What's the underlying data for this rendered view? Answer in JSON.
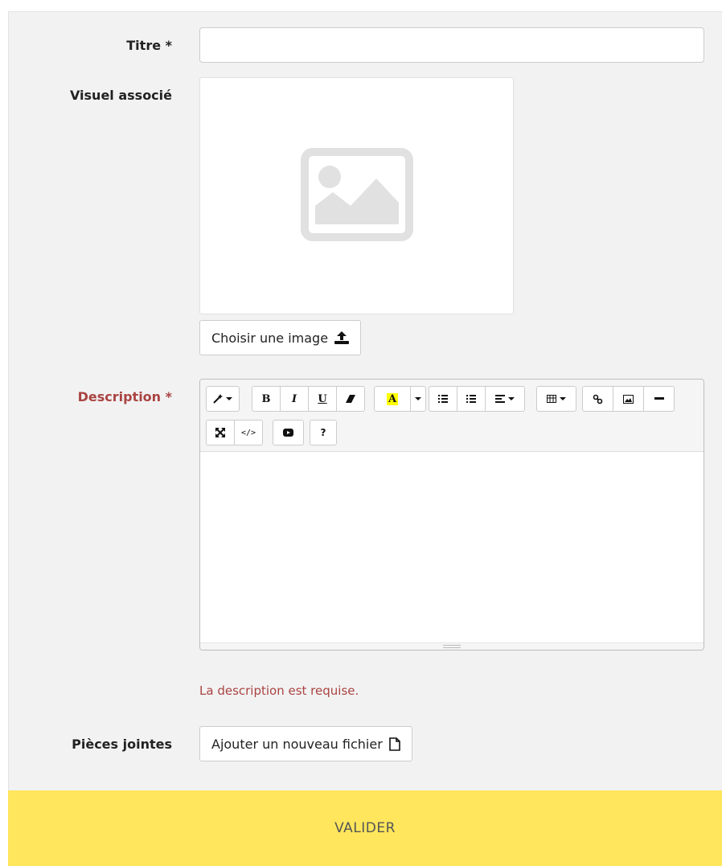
{
  "form": {
    "title_label": "Titre *",
    "title_value": "",
    "visual_label": "Visuel associé",
    "choose_image_label": "Choisir une image",
    "description_label": "Description *",
    "description_error": "La description est requise.",
    "attachments_label": "Pièces jointes",
    "add_file_label": "Ajouter un nouveau fichier",
    "submit_label": "VALIDER"
  },
  "editor": {
    "toolbar": {
      "style": "magic-wand-icon",
      "bold": "B",
      "italic": "I",
      "underline": "U",
      "clear": "eraser-icon",
      "color": "A",
      "ol": "ordered-list-icon",
      "ul": "unordered-list-icon",
      "align": "align-icon",
      "table": "table-icon",
      "link": "link-icon",
      "picture": "picture-icon",
      "hr": "horizontal-rule-icon",
      "fullscreen": "fullscreen-icon",
      "codeview": "code-view-icon",
      "video": "video-icon",
      "help": "?"
    }
  },
  "colors": {
    "error": "#a94442",
    "submit_bg": "#ffe65c",
    "panel_bg": "#f2f2f2",
    "highlight": "#ffff00"
  }
}
